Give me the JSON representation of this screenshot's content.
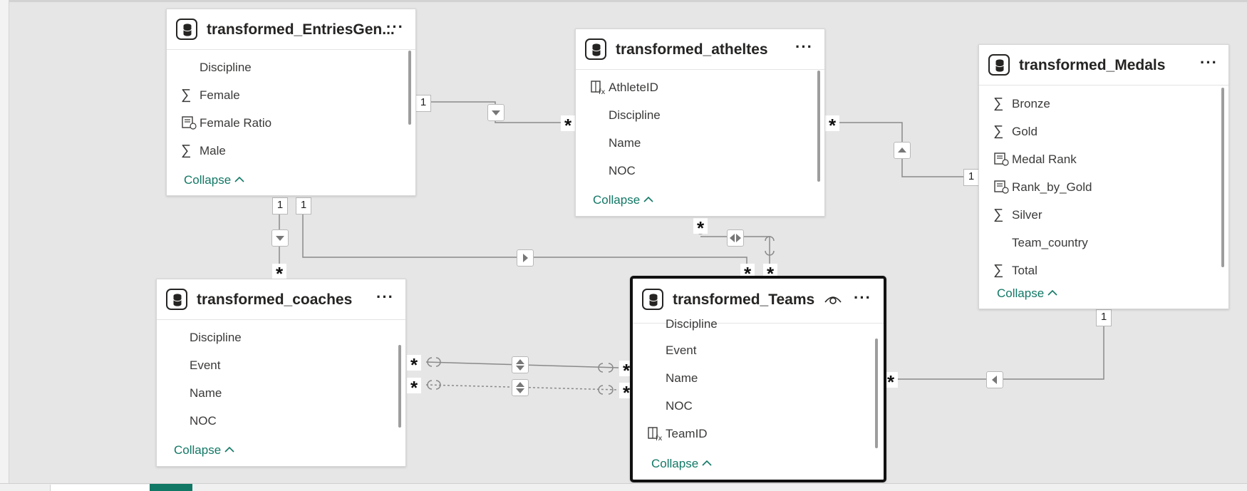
{
  "tables": [
    {
      "name": "transformed_EntriesGen...",
      "fields": [
        {
          "label": "Discipline",
          "icon": "none"
        },
        {
          "label": "Female",
          "icon": "sigma"
        },
        {
          "label": "Female Ratio",
          "icon": "measure"
        },
        {
          "label": "Male",
          "icon": "sigma"
        }
      ],
      "collapse": "Collapse"
    },
    {
      "name": "transformed_atheltes",
      "fields": [
        {
          "label": "AthleteID",
          "icon": "calc-column"
        },
        {
          "label": "Discipline",
          "icon": "none"
        },
        {
          "label": "Name",
          "icon": "none"
        },
        {
          "label": "NOC",
          "icon": "none"
        }
      ],
      "collapse": "Collapse"
    },
    {
      "name": "transformed_Medals",
      "fields": [
        {
          "label": "Bronze",
          "icon": "sigma"
        },
        {
          "label": "Gold",
          "icon": "sigma"
        },
        {
          "label": "Medal Rank",
          "icon": "measure"
        },
        {
          "label": "Rank_by_Gold",
          "icon": "measure"
        },
        {
          "label": "Silver",
          "icon": "sigma"
        },
        {
          "label": "Team_country",
          "icon": "none"
        },
        {
          "label": "Total",
          "icon": "sigma"
        }
      ],
      "collapse": "Collapse"
    },
    {
      "name": "transformed_coaches",
      "fields": [
        {
          "label": "Discipline",
          "icon": "none"
        },
        {
          "label": "Event",
          "icon": "none"
        },
        {
          "label": "Name",
          "icon": "none"
        },
        {
          "label": "NOC",
          "icon": "none"
        }
      ],
      "collapse": "Collapse"
    },
    {
      "name": "transformed_Teams",
      "fields": [
        {
          "label": "Discipline",
          "icon": "none"
        },
        {
          "label": "Event",
          "icon": "none"
        },
        {
          "label": "Name",
          "icon": "none"
        },
        {
          "label": "NOC",
          "icon": "none"
        },
        {
          "label": "TeamID",
          "icon": "calc-column"
        }
      ],
      "collapse": "Collapse"
    }
  ],
  "cardinality": {
    "one": "1",
    "many": "*"
  },
  "icons": {
    "table": "table-database-icon",
    "more": "more-options-icon",
    "eye": "visibility-eye-icon",
    "sigma": "sum-icon",
    "measure": "measure-icon",
    "calc_column": "calculated-column-icon",
    "collapse": "chevron-up-icon"
  },
  "colors": {
    "canvas": "#e6e6e6",
    "accent": "#117865",
    "text": "#252423",
    "line": "#8a8a8a"
  }
}
